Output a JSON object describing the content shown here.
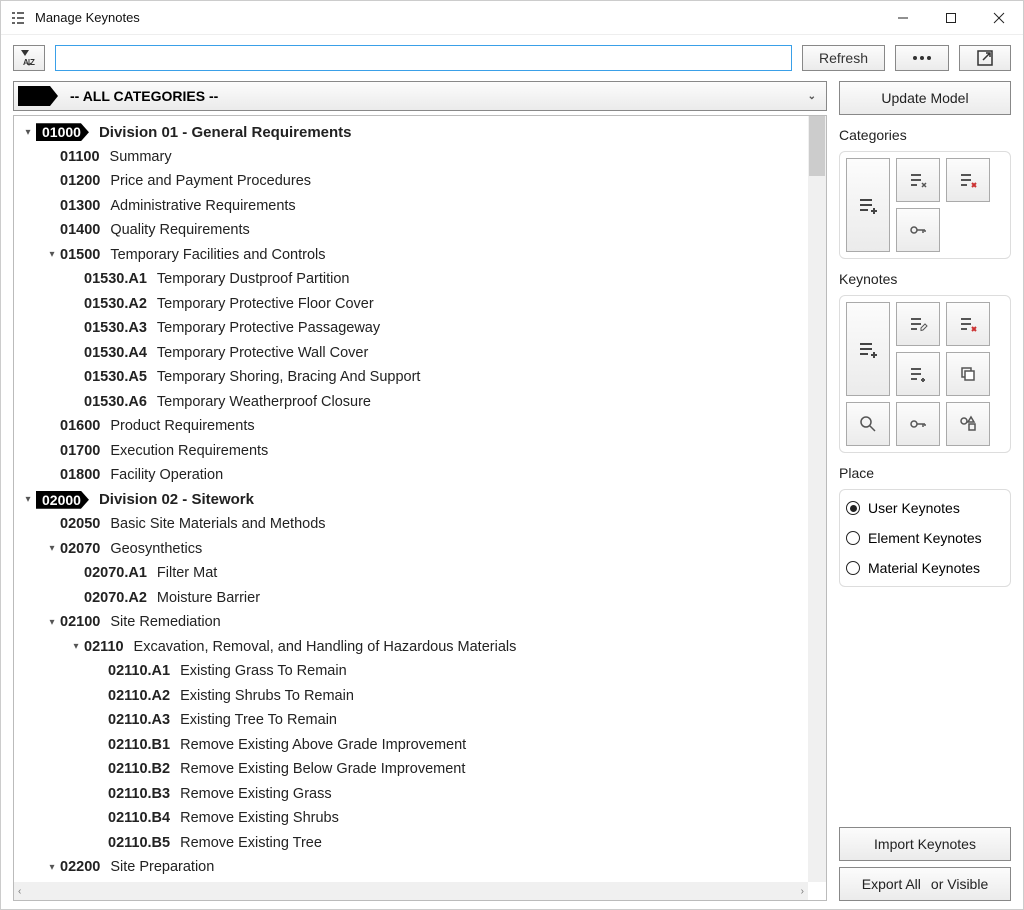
{
  "window": {
    "title": "Manage Keynotes"
  },
  "toolbar": {
    "search_value": "",
    "refresh": "Refresh"
  },
  "dropdown": {
    "label": "-- ALL CATEGORIES --"
  },
  "tree": [
    {
      "depth": 0,
      "expander": "▾",
      "tag": true,
      "code": "01000",
      "label": "Division 01 - General Requirements",
      "bold": true
    },
    {
      "depth": 1,
      "expander": "",
      "tag": false,
      "code": "01100",
      "label": "Summary"
    },
    {
      "depth": 1,
      "expander": "",
      "tag": false,
      "code": "01200",
      "label": "Price and Payment Procedures"
    },
    {
      "depth": 1,
      "expander": "",
      "tag": false,
      "code": "01300",
      "label": "Administrative Requirements"
    },
    {
      "depth": 1,
      "expander": "",
      "tag": false,
      "code": "01400",
      "label": "Quality Requirements"
    },
    {
      "depth": 1,
      "expander": "▾",
      "tag": false,
      "code": "01500",
      "label": "Temporary Facilities and Controls"
    },
    {
      "depth": 2,
      "expander": "",
      "tag": false,
      "code": "01530.A1",
      "label": "Temporary Dustproof Partition"
    },
    {
      "depth": 2,
      "expander": "",
      "tag": false,
      "code": "01530.A2",
      "label": "Temporary Protective Floor Cover"
    },
    {
      "depth": 2,
      "expander": "",
      "tag": false,
      "code": "01530.A3",
      "label": "Temporary Protective Passageway"
    },
    {
      "depth": 2,
      "expander": "",
      "tag": false,
      "code": "01530.A4",
      "label": "Temporary Protective Wall Cover"
    },
    {
      "depth": 2,
      "expander": "",
      "tag": false,
      "code": "01530.A5",
      "label": "Temporary Shoring, Bracing And Support"
    },
    {
      "depth": 2,
      "expander": "",
      "tag": false,
      "code": "01530.A6",
      "label": "Temporary Weatherproof Closure"
    },
    {
      "depth": 1,
      "expander": "",
      "tag": false,
      "code": "01600",
      "label": "Product Requirements"
    },
    {
      "depth": 1,
      "expander": "",
      "tag": false,
      "code": "01700",
      "label": "Execution Requirements"
    },
    {
      "depth": 1,
      "expander": "",
      "tag": false,
      "code": "01800",
      "label": "Facility Operation"
    },
    {
      "depth": 0,
      "expander": "▾",
      "tag": true,
      "code": "02000",
      "label": "Division 02 - Sitework",
      "bold": true
    },
    {
      "depth": 1,
      "expander": "",
      "tag": false,
      "code": "02050",
      "label": "Basic Site Materials and Methods"
    },
    {
      "depth": 1,
      "expander": "▾",
      "tag": false,
      "code": "02070",
      "label": "Geosynthetics"
    },
    {
      "depth": 2,
      "expander": "",
      "tag": false,
      "code": "02070.A1",
      "label": "Filter Mat"
    },
    {
      "depth": 2,
      "expander": "",
      "tag": false,
      "code": "02070.A2",
      "label": "Moisture Barrier"
    },
    {
      "depth": 1,
      "expander": "▾",
      "tag": false,
      "code": "02100",
      "label": "Site Remediation"
    },
    {
      "depth": 2,
      "expander": "▾",
      "tag": false,
      "code": "02110",
      "label": "Excavation, Removal, and Handling of Hazardous Materials"
    },
    {
      "depth": 3,
      "expander": "",
      "tag": false,
      "code": "02110.A1",
      "label": "Existing Grass To Remain"
    },
    {
      "depth": 3,
      "expander": "",
      "tag": false,
      "code": "02110.A2",
      "label": "Existing Shrubs To Remain"
    },
    {
      "depth": 3,
      "expander": "",
      "tag": false,
      "code": "02110.A3",
      "label": "Existing Tree To Remain"
    },
    {
      "depth": 3,
      "expander": "",
      "tag": false,
      "code": "02110.B1",
      "label": "Remove Existing Above Grade Improvement"
    },
    {
      "depth": 3,
      "expander": "",
      "tag": false,
      "code": "02110.B2",
      "label": "Remove Existing Below Grade Improvement"
    },
    {
      "depth": 3,
      "expander": "",
      "tag": false,
      "code": "02110.B3",
      "label": "Remove Existing Grass"
    },
    {
      "depth": 3,
      "expander": "",
      "tag": false,
      "code": "02110.B4",
      "label": "Remove Existing Shrubs"
    },
    {
      "depth": 3,
      "expander": "",
      "tag": false,
      "code": "02110.B5",
      "label": "Remove Existing Tree"
    },
    {
      "depth": 1,
      "expander": "▾",
      "tag": false,
      "code": "02200",
      "label": "Site Preparation"
    }
  ],
  "sidebar": {
    "update_model": "Update Model",
    "categories_label": "Categories",
    "keynotes_label": "Keynotes",
    "place_label": "Place",
    "place_options": [
      "User Keynotes",
      "Element Keynotes",
      "Material Keynotes"
    ],
    "import": "Import Keynotes",
    "export_all": "Export All",
    "export_visible": "or Visible"
  }
}
